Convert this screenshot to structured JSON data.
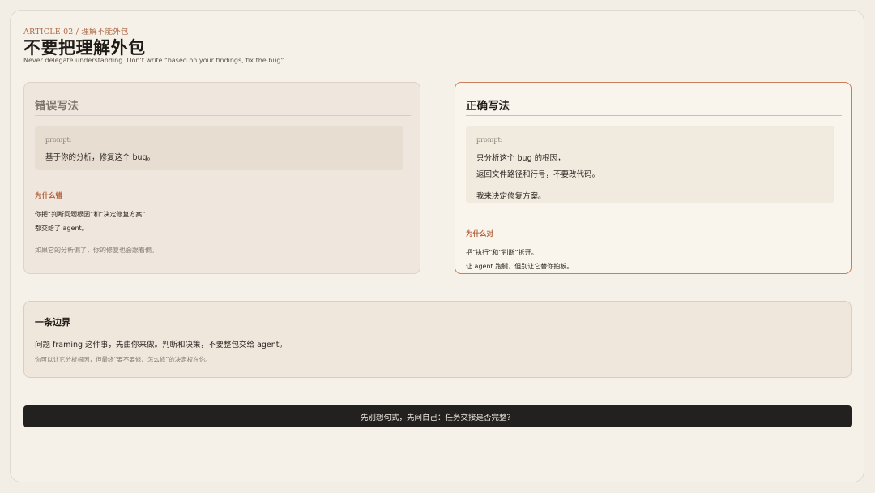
{
  "header": {
    "kicker": "ARTICLE 02 / 理解不能外包",
    "title": "不要把理解外包",
    "subtitle": "Never delegate understanding. Don't write \"based on your findings, fix the bug\""
  },
  "wrong_card": {
    "title": "错误写法",
    "prompt_label": "prompt:",
    "prompt_lines": [
      "基于你的分析，修复这个 bug。"
    ],
    "why_heading": "为什么错",
    "why_lines": [
      "你把“判断问题根因”和“决定修复方案”",
      "都交给了 agent。"
    ],
    "note": "如果它的分析偏了，你的修复也会跟着偏。"
  },
  "right_card": {
    "title": "正确写法",
    "prompt_label": "prompt:",
    "prompt_lines": [
      "只分析这个 bug 的根因，",
      "返回文件路径和行号，不要改代码。",
      "我来决定修复方案。"
    ],
    "why_heading": "为什么对",
    "why_lines": [
      "把“执行”和“判断”拆开。",
      "让 agent 跑腿，但别让它替你拍板。"
    ]
  },
  "boundary": {
    "title": "一条边界",
    "statement": "问题 framing 这件事，先由你来做。判断和决策，不要整包交给 agent。",
    "note": "你可以让它分析根因，但最终“要不要修、怎么修”的决定权在你。"
  },
  "footer": {
    "text": "先别想句式，先问自己：任务交接是否完整？"
  }
}
